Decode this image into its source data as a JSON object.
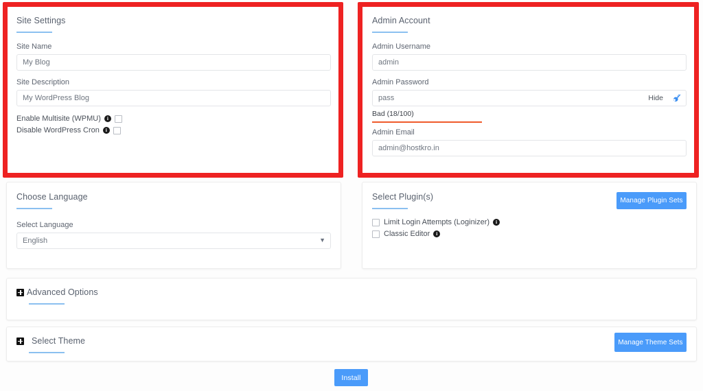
{
  "site_settings": {
    "title": "Site Settings",
    "site_name_label": "Site Name",
    "site_name_value": "My Blog",
    "site_desc_label": "Site Description",
    "site_desc_value": "My WordPress Blog",
    "multisite_label": "Enable Multisite (WPMU)",
    "cron_label": "Disable WordPress Cron",
    "info_glyph": "i"
  },
  "admin_account": {
    "title": "Admin Account",
    "username_label": "Admin Username",
    "username_value": "admin",
    "password_label": "Admin Password",
    "password_value": "pass",
    "hide_label": "Hide",
    "key_icon": "key-icon",
    "strength_text": "Bad (18/100)",
    "strength_color": "#ef5a2b",
    "email_label": "Admin Email",
    "email_value": "admin@hostkro.in"
  },
  "choose_language": {
    "title": "Choose Language",
    "select_label": "Select Language",
    "selected": "English",
    "options": [
      "English"
    ],
    "caret_icon": "chevron-down-icon"
  },
  "select_plugins": {
    "title": "Select Plugin(s)",
    "manage_button": "Manage Plugin Sets",
    "plugins": [
      {
        "label": "Limit Login Attempts (Loginizer)",
        "checked": false
      },
      {
        "label": "Classic Editor",
        "checked": false
      }
    ],
    "info_glyph": "i"
  },
  "advanced_options": {
    "title": "Advanced Options",
    "expand_icon": "plus-square-icon"
  },
  "select_theme": {
    "title": "Select Theme",
    "expand_icon": "plus-square-icon",
    "manage_button": "Manage Theme Sets"
  },
  "install": {
    "label": "Install"
  },
  "highlights": {
    "accent_blue": "#4a9bfa",
    "highlight_red": "#ee2222",
    "underline_blue": "#8bc0f0"
  }
}
